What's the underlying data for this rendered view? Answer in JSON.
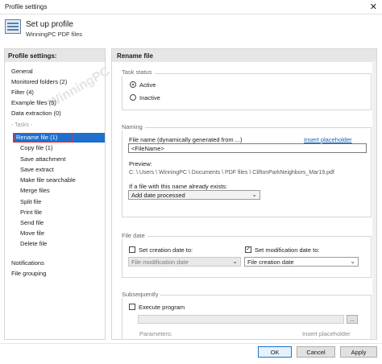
{
  "window": {
    "title": "Profile settings",
    "close_glyph": "✕"
  },
  "header": {
    "title": "Set up profile",
    "subtitle": "WinningPC PDF files",
    "icon": "profile-settings-icon"
  },
  "sidebar": {
    "heading": "Profile settings:",
    "items": [
      {
        "label": "General"
      },
      {
        "label": "Monitored folders (2)"
      },
      {
        "label": "Filter (4)"
      },
      {
        "label": "Example files (5)"
      },
      {
        "label": "Data extraction (0)"
      }
    ],
    "tasks_label": "Tasks",
    "tasks": [
      {
        "label": "Rename file (1)",
        "selected": true
      },
      {
        "label": "Copy file (1)"
      },
      {
        "label": "Save attachment"
      },
      {
        "label": "Save extract"
      },
      {
        "label": "Make file searchable"
      },
      {
        "label": "Merge files"
      },
      {
        "label": "Split file"
      },
      {
        "label": "Print file"
      },
      {
        "label": "Send file"
      },
      {
        "label": "Move file"
      },
      {
        "label": "Delete file"
      }
    ],
    "bottom": [
      {
        "label": "Notifications"
      },
      {
        "label": "File grouping"
      }
    ]
  },
  "panel": {
    "heading": "Rename file",
    "task_status": {
      "label": "Task status",
      "active": "Active",
      "inactive": "Inactive",
      "selected": "Active"
    },
    "naming": {
      "label": "Naming",
      "file_name_label": "File name (dynamically generated from ...)",
      "insert_placeholder": "Insert placeholder",
      "file_name_value": "<FileName>",
      "preview_label": "Preview:",
      "preview_value": "C: \\ Users \\ WinningPC \\ Documents \\ PDF files \\ CliftonParkNeighbors_Mar19.pdf",
      "exists_label": "If a file with this name already exists:",
      "exists_value": "Add date processed"
    },
    "file_date": {
      "label": "File date",
      "creation_label": "Set creation date to:",
      "creation_checked": false,
      "creation_value": "File modification date",
      "modification_label": "Set modification date to:",
      "modification_checked": true,
      "modification_value": "File creation date"
    },
    "subsequently": {
      "label": "Subsequently",
      "execute_label": "Execute program",
      "execute_checked": false,
      "browse_label": "...",
      "parameters_label": "Parameters:",
      "insert_placeholder": "Insert placeholder"
    }
  },
  "buttons": {
    "ok": "OK",
    "cancel": "Cancel",
    "apply": "Apply"
  },
  "watermark": "WinningPC",
  "colors": {
    "selection": "#1f6fcc",
    "highlight_ring": "#d9363e",
    "link": "#1a5fb4"
  }
}
